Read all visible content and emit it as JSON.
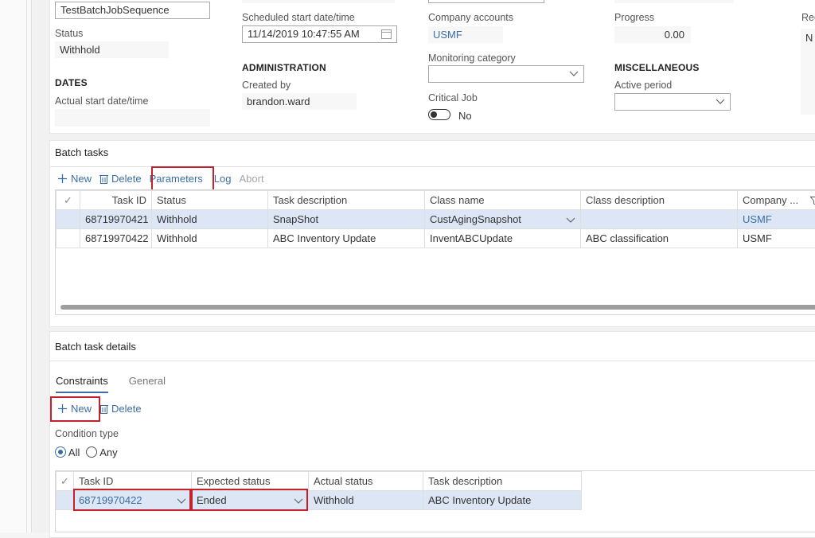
{
  "job": {
    "name_value": "TestBatchJobSequence",
    "status_label": "Status",
    "status_value": "Withhold",
    "dates_heading": "DATES",
    "actual_start_label": "Actual start date/time",
    "actual_start_value": "",
    "scheduled_start_label": "Scheduled start date/time",
    "scheduled_start_value": "11/14/2019 10:47:55 AM",
    "administration_heading": "ADMINISTRATION",
    "created_by_label": "Created by",
    "created_by_value": "brandon.ward",
    "company_accounts_label": "Company accounts",
    "company_accounts_value": "USMF",
    "monitoring_category_label": "Monitoring category",
    "monitoring_category_value": "",
    "critical_job_label": "Critical Job",
    "critical_job_value": "No",
    "progress_label": "Progress",
    "progress_value": "0.00",
    "misc_heading": "MISCELLANEOUS",
    "active_period_label": "Active period",
    "active_period_value": "",
    "rec_label_partial": "Rec",
    "rec_value_partial": "N"
  },
  "batch_tasks": {
    "title": "Batch tasks",
    "toolbar": {
      "new": "New",
      "delete": "Delete",
      "parameters": "Parameters",
      "log": "Log",
      "abort": "Abort"
    },
    "columns": [
      "Task ID",
      "Status",
      "Task description",
      "Class name",
      "Class description",
      "Company ..."
    ],
    "rows": [
      {
        "task_id": "68719970421",
        "status": "Withhold",
        "description": "SnapShot",
        "class_name": "CustAgingSnapshot",
        "class_description": "",
        "company": "USMF",
        "selected": true
      },
      {
        "task_id": "68719970422",
        "status": "Withhold",
        "description": "ABC Inventory Update",
        "class_name": "InventABCUpdate",
        "class_description": "ABC classification",
        "company": "USMF",
        "selected": false
      }
    ]
  },
  "batch_task_details": {
    "title": "Batch task details",
    "tabs": [
      {
        "label": "Constraints",
        "active": true
      },
      {
        "label": "General",
        "active": false
      }
    ],
    "toolbar": {
      "new": "New",
      "delete": "Delete"
    },
    "condition_type_label": "Condition type",
    "condition_options": [
      {
        "label": "All",
        "selected": true
      },
      {
        "label": "Any",
        "selected": false
      }
    ],
    "columns": [
      "Task ID",
      "Expected status",
      "Actual status",
      "Task description"
    ],
    "rows": [
      {
        "task_id": "68719970422",
        "expected_status": "Ended",
        "actual_status": "Withhold",
        "description": "ABC Inventory Update"
      }
    ]
  },
  "colors": {
    "accent": "#3a6ea5",
    "highlight_box": "#c3212b",
    "selected_row": "#dde6f5"
  }
}
